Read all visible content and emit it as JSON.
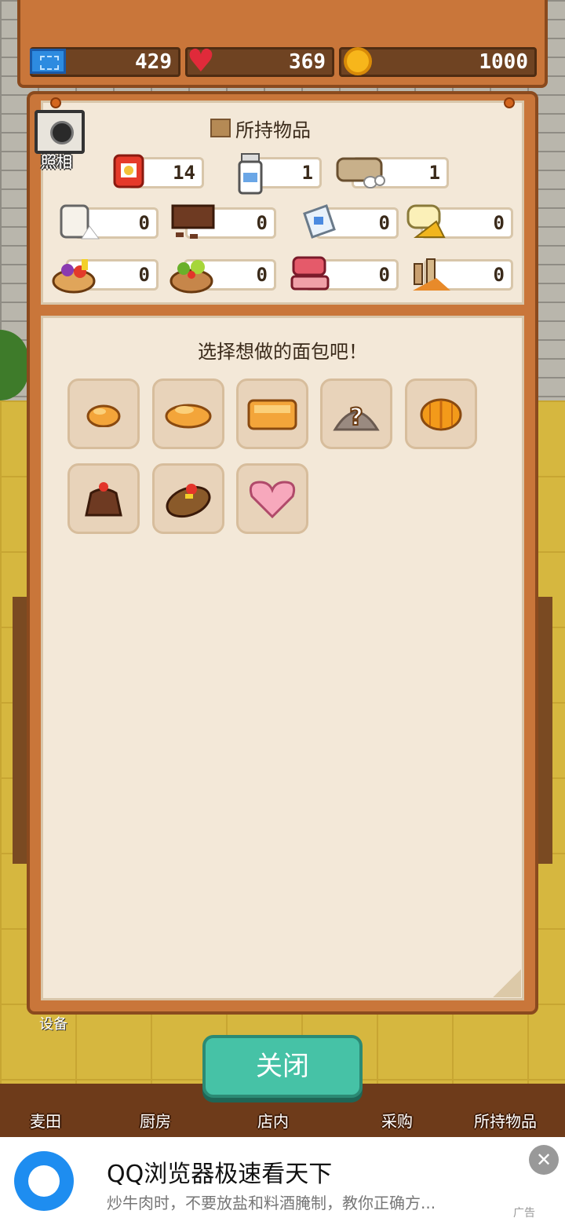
{
  "status": {
    "tickets": "429",
    "hearts": "369",
    "coins": "1000"
  },
  "camera": {
    "label": "照相"
  },
  "inventory": {
    "title": "所持物品",
    "items": [
      {
        "icon": "flour-bag-icon",
        "count": "14"
      },
      {
        "icon": "milk-bottle-icon",
        "count": "1"
      },
      {
        "icon": "eggs-icon",
        "count": "1"
      },
      {
        "icon": "sugar-jar-icon",
        "count": "0"
      },
      {
        "icon": "chocolate-icon",
        "count": "0"
      },
      {
        "icon": "salt-icon",
        "count": "0"
      },
      {
        "icon": "cheese-icon",
        "count": "0"
      },
      {
        "icon": "fruit-basket-icon",
        "count": "0"
      },
      {
        "icon": "vegetable-basket-icon",
        "count": "0"
      },
      {
        "icon": "meat-icon",
        "count": "0"
      },
      {
        "icon": "spices-icon",
        "count": "0"
      }
    ]
  },
  "bread": {
    "prompt": "选择想做的面包吧！",
    "items": [
      {
        "icon": "small-roll-icon"
      },
      {
        "icon": "bun-icon"
      },
      {
        "icon": "loaf-icon"
      },
      {
        "icon": "unknown-bread-icon"
      },
      {
        "icon": "pumpkin-bread-icon"
      },
      {
        "icon": "chocolate-cake-icon"
      },
      {
        "icon": "fruit-roll-icon"
      },
      {
        "icon": "heart-bread-icon"
      }
    ]
  },
  "background": {
    "equipment_label": "设备"
  },
  "nav": {
    "field": "麦田",
    "kitchen": "厨房",
    "store": "店内",
    "purchase": "采购",
    "items": "所持物品"
  },
  "close_label": "关闭",
  "ad": {
    "title": "QQ浏览器极速看天下",
    "subtitle": "炒牛肉时，不要放盐和料酒腌制，教你正确方...",
    "tag": "广告",
    "close": "✕"
  }
}
